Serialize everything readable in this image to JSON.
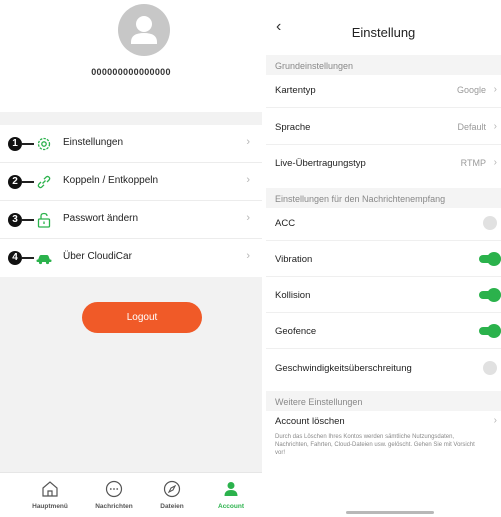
{
  "account": {
    "user_id": "000000000000000",
    "menu": [
      {
        "badge": "1",
        "label": "Einstellungen",
        "icon": "gear-icon"
      },
      {
        "badge": "2",
        "label": "Koppeln / Entkoppeln",
        "icon": "link-icon"
      },
      {
        "badge": "3",
        "label": "Passwort ändern",
        "icon": "unlock-icon"
      },
      {
        "badge": "4",
        "label": "Über CloudiCar",
        "icon": "car-icon"
      }
    ],
    "logout_label": "Logout",
    "tabs": [
      {
        "label": "Hauptmenü",
        "icon": "home-icon"
      },
      {
        "label": "Nachrichten",
        "icon": "chat-icon"
      },
      {
        "label": "Dateien",
        "icon": "compass-icon"
      },
      {
        "label": "Account",
        "icon": "person-icon",
        "active": true
      }
    ],
    "accent_color": "#f05a28",
    "active_tab_color": "#2bb24c"
  },
  "settings": {
    "title": "Einstellung",
    "sections": [
      {
        "title": "Grundeinstellungen"
      },
      {
        "title": "Einstellungen für den Nachrichtenempfang"
      },
      {
        "title": "Weitere Einstellungen"
      }
    ],
    "basic_rows": [
      {
        "label": "Kartentyp",
        "value": "Google"
      },
      {
        "label": "Sprache",
        "value": "Default"
      },
      {
        "label": "Live-Übertragungstyp",
        "value": "RTMP"
      }
    ],
    "toggles": [
      {
        "label": "ACC",
        "on": false
      },
      {
        "label": "Vibration",
        "on": true
      },
      {
        "label": "Kollision",
        "on": true
      },
      {
        "label": "Geofence",
        "on": true
      },
      {
        "label": "Geschwindigkeitsüberschreitung",
        "on": false
      }
    ],
    "delete_account": "Account löschen",
    "note_line1": "Durch das Löschen Ihres Kontos werden sämtliche Nutzungsdaten,",
    "note_line2": "Nachrichten, Fahrten, Cloud-Dateien usw. gelöscht. Gehen Sie mit Vorsicht",
    "note_line3": "vor!",
    "toggle_on_color": "#2bb24c"
  }
}
